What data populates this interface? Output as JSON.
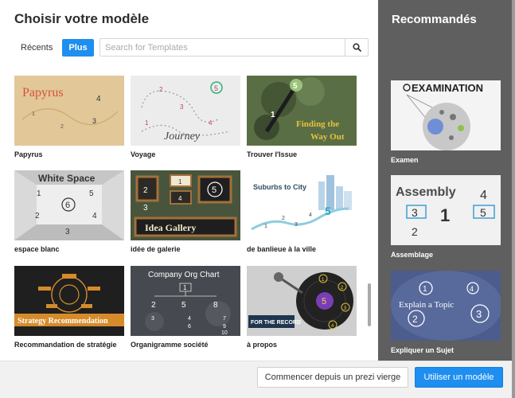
{
  "header": {
    "title": "Choisir votre modèle",
    "tabs": [
      {
        "label": "Récents",
        "active": false
      },
      {
        "label": "Plus",
        "active": true
      }
    ],
    "search": {
      "placeholder": "Search for Templates",
      "icon": "search-icon"
    }
  },
  "templates": [
    {
      "name": "Papyrus",
      "thumb_text": [
        "Papyrus",
        "4",
        "1",
        "2",
        "3"
      ]
    },
    {
      "name": "Voyage",
      "thumb_text": [
        "2",
        "5",
        "3",
        "4",
        "1",
        "Journey"
      ]
    },
    {
      "name": "Trouver l'Issue",
      "thumb_text": [
        "5",
        "1",
        "Finding the",
        "Way Out"
      ]
    },
    {
      "name": "espace blanc",
      "thumb_text": [
        "White Space",
        "1",
        "5",
        "6",
        "2",
        "4",
        "3"
      ]
    },
    {
      "name": "idée de galerie",
      "thumb_text": [
        "2",
        "1",
        "3",
        "5",
        "4",
        "Idea Gallery"
      ]
    },
    {
      "name": "de banlieue à la ville",
      "thumb_text": [
        "Suburbs to City",
        "1",
        "2",
        "3",
        "4",
        "5"
      ]
    },
    {
      "name": "Recommandation de stratégie",
      "thumb_text": [
        "Strategy Recommendation"
      ]
    },
    {
      "name": "Organigramme société",
      "thumb_text": [
        "Company Org Chart",
        "1",
        "2",
        "5",
        "8",
        "3",
        "4",
        "6",
        "7",
        "9",
        "10"
      ]
    },
    {
      "name": "à propos",
      "thumb_text": [
        "1",
        "2",
        "3",
        "4",
        "5",
        "FOR THE RECORD"
      ]
    }
  ],
  "sidebar": {
    "title": "Recommandés",
    "items": [
      {
        "name": "Examen",
        "thumb_text": [
          "EXAMINATION"
        ]
      },
      {
        "name": "Assemblage",
        "thumb_text": [
          "Assembly",
          "4",
          "3",
          "1",
          "5",
          "2"
        ]
      },
      {
        "name": "Expliquer un Sujet",
        "thumb_text": [
          "1",
          "4",
          "Explain a Topic",
          "2",
          "3"
        ]
      }
    ]
  },
  "footer": {
    "blank_button": "Commencer depuis un prezi vierge",
    "use_button": "Utiliser un modèle"
  },
  "colors": {
    "accent": "#1e8ef0",
    "sidebar_bg": "#5f5f5f",
    "footer_bg": "#f1f1f1"
  }
}
